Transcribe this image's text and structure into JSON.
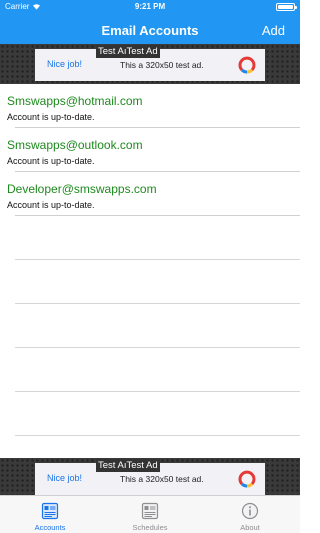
{
  "status_bar": {
    "carrier": "Carrier",
    "time": "9:21 PM"
  },
  "nav": {
    "title": "Email Accounts",
    "add_label": "Add"
  },
  "ad": {
    "label": "Test Ad",
    "label_overlap": "Test Aı",
    "nice": "Nice job!",
    "description": "This a 320x50 test ad."
  },
  "accounts": [
    {
      "email": "Smswapps@hotmail.com",
      "status": "Account is up-to-date."
    },
    {
      "email": "Smswapps@outlook.com",
      "status": "Account is up-to-date."
    },
    {
      "email": "Developer@smswapps.com",
      "status": "Account is up-to-date."
    }
  ],
  "tabs": [
    {
      "label": "Accounts",
      "icon": "accounts-icon",
      "active": true
    },
    {
      "label": "Schedules",
      "icon": "schedules-icon",
      "active": false
    },
    {
      "label": "About",
      "icon": "info-icon",
      "active": false
    }
  ],
  "colors": {
    "nav_bar": "#2196f3",
    "email_text": "#1e8a1e",
    "tab_active": "#1a73e8"
  }
}
